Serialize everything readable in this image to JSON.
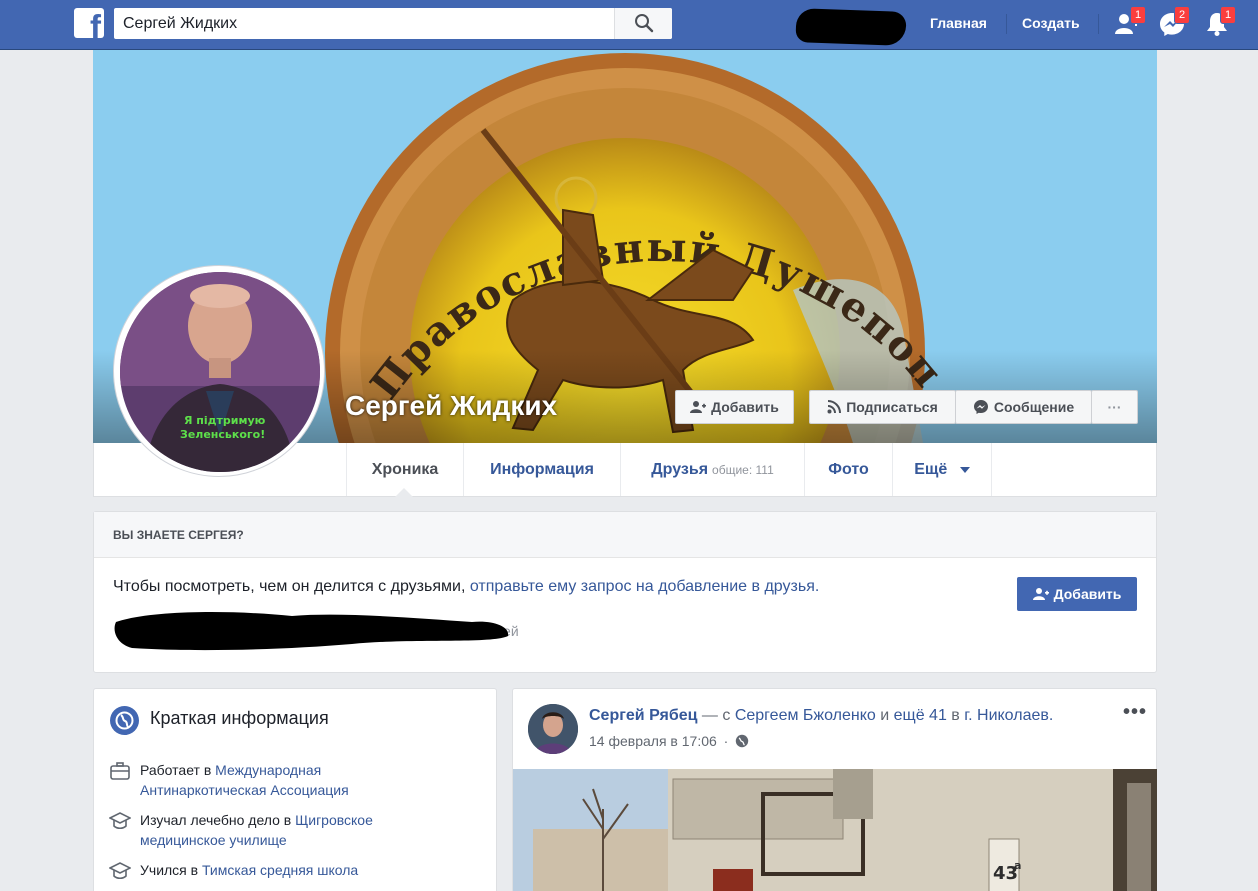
{
  "topbar": {
    "search_value": "Сергей Жидких",
    "nav": {
      "home": "Главная",
      "create": "Создать"
    },
    "badges": {
      "friends": "1",
      "messages": "2",
      "notifications": "1"
    },
    "icons": {
      "logo": "facebook-logo",
      "search": "search-icon",
      "friends": "friend-requests-icon",
      "messages": "messenger-icon",
      "notifications": "bell-icon"
    }
  },
  "cover": {
    "emblem_text": "Православный Душепопечительский Центр",
    "profile_name": "Сергей Жидких",
    "avatar_overlay": "Я підтримую Зеленського!",
    "buttons": {
      "add": "Добавить",
      "follow": "Подписаться",
      "message": "Сообщение",
      "more": "···"
    }
  },
  "tabs": [
    {
      "label": "Хроника",
      "sub": ""
    },
    {
      "label": "Информация",
      "sub": ""
    },
    {
      "label": "Друзья",
      "sub": "общие: 111"
    },
    {
      "label": "Фото",
      "sub": ""
    },
    {
      "label": "Ещё",
      "sub": ""
    }
  ],
  "request_card": {
    "header": "ВЫ ЗНАЕТЕ СЕРГЕЯ?",
    "text": "Чтобы посмотреть, чем он делится с друзьями, ",
    "link": "отправьте ему запрос на добавление в друзья.",
    "add_button": "Добавить",
    "mutual_tail": "друзей"
  },
  "intro": {
    "title": "Краткая информация",
    "items": [
      {
        "prefix": "Работает в ",
        "link": "Международная Антинаркотическая Ассоциация",
        "icon": "briefcase-icon"
      },
      {
        "prefix": "Изучал лечебно дело в ",
        "link": "Щигровское медицинское училище",
        "icon": "graduation-cap-icon"
      },
      {
        "prefix": "Учился в ",
        "link": "Тимская средняя школа",
        "icon": "graduation-cap-icon"
      }
    ]
  },
  "post": {
    "author": "Сергей Рябец",
    "with_text": " — с ",
    "with_person": "Сергеем Бжоленко",
    "and_text": " и ",
    "others": "ещё 41",
    "in_text": " в ",
    "place": "г. Николаев.",
    "time": "14 февраля в 17:06",
    "more": "•••",
    "house_number": "43",
    "house_letter": "а"
  },
  "colors": {
    "brand": "#4267b2",
    "link": "#365899",
    "badge": "#fa3e3e",
    "background": "#e9ebee"
  }
}
